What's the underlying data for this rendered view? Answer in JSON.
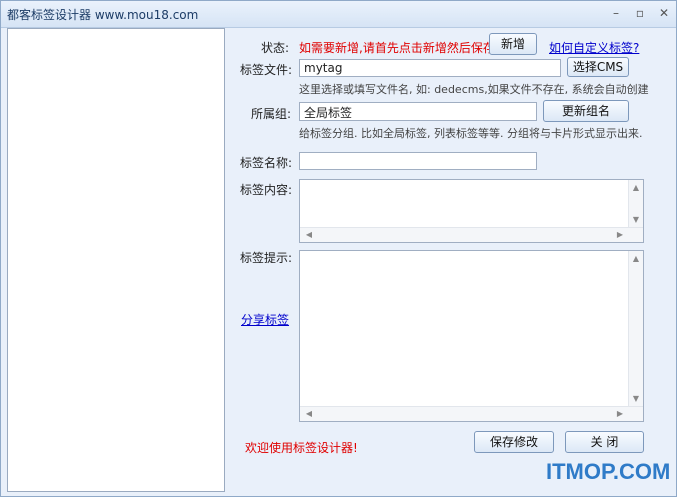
{
  "window": {
    "title": "都客标签设计器 www.mou18.com",
    "minimize": "–",
    "maximize": "▫",
    "close": "✕"
  },
  "status": {
    "label": "状态:",
    "message": "如需要新增,请首先点击新增然后保存!",
    "new_button": "新增",
    "help_link": "如何自定义标签?"
  },
  "tag_file": {
    "label": "标签文件:",
    "value": "mytag",
    "select_button": "选择CMS",
    "hint": "这里选择或填写文件名, 如: dedecms,如果文件不存在, 系统会自动创建"
  },
  "group": {
    "label": "所属组:",
    "value": "全局标签",
    "update_button": "更新组名",
    "hint": "给标签分组. 比如全局标签, 列表标签等等. 分组将与卡片形式显示出来."
  },
  "tag_name": {
    "label": "标签名称:",
    "value": ""
  },
  "tag_content": {
    "label": "标签内容:"
  },
  "tag_tip": {
    "label": "标签提示:"
  },
  "share_link": "分享标签",
  "welcome": "欢迎使用标签设计器!",
  "save_button": "保存修改",
  "close_button": "关 闭",
  "watermark": "ITMOP.COM"
}
